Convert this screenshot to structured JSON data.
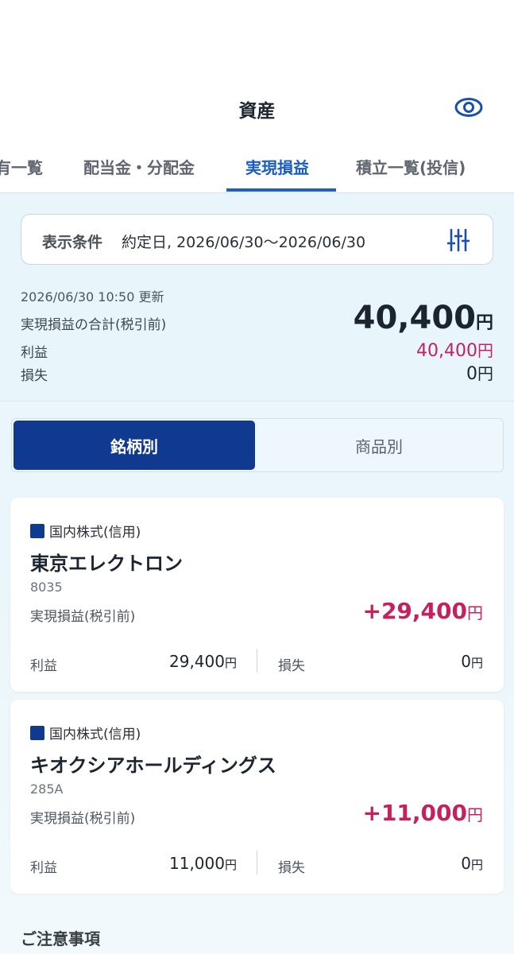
{
  "header": {
    "title": "資産",
    "eye_icon": "eye-icon"
  },
  "tabs": [
    {
      "label": "有一覧",
      "active": false
    },
    {
      "label": "配当金・分配金",
      "active": false
    },
    {
      "label": "実現損益",
      "active": true
    },
    {
      "label": "積立一覧(投信)",
      "active": false
    }
  ],
  "filter": {
    "label": "表示条件",
    "value": "約定日, 2026/06/30〜2026/06/30",
    "icon": "sliders-icon"
  },
  "summary": {
    "updated": "2026/06/30 10:50 更新",
    "total_label": "実現損益の合計(税引前)",
    "total_value": "40,400",
    "yen": "円",
    "profit_label": "利益",
    "profit_value": "40,400",
    "loss_label": "損失",
    "loss_value": "0"
  },
  "segment": {
    "by_stock": "銘柄別",
    "by_product": "商品別"
  },
  "cards": [
    {
      "category": "国内株式(信用)",
      "name": "東京エレクトロン",
      "code": "8035",
      "pl_label": "実現損益(税引前)",
      "pl_value": "+29,400",
      "profit_label": "利益",
      "profit_value": "29,400",
      "loss_label": "損失",
      "loss_value": "0",
      "yen": "円"
    },
    {
      "category": "国内株式(信用)",
      "name": "キオクシアホールディングス",
      "code": "285A",
      "pl_label": "実現損益(税引前)",
      "pl_value": "+11,000",
      "profit_label": "利益",
      "profit_value": "11,000",
      "loss_label": "損失",
      "loss_value": "0",
      "yen": "円"
    }
  ],
  "notes_title": "ご注意事項",
  "colors": {
    "accent": "#1b5bc4",
    "navy": "#0f3a8f",
    "profit": "#c4215e"
  }
}
